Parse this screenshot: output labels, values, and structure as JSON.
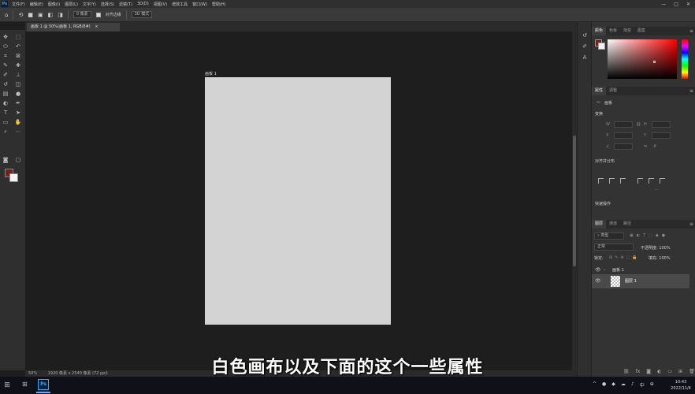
{
  "menubar": {
    "logo": "Ps",
    "items": [
      "文件(F)",
      "编辑(E)",
      "图像(I)",
      "图层(L)",
      "文字(Y)",
      "选择(S)",
      "滤镜(T)",
      "3D(D)",
      "视图(V)",
      "增效工具",
      "窗口(W)",
      "帮助(H)"
    ],
    "window_controls": [
      "—",
      "□",
      "✕"
    ]
  },
  "options": {
    "home_icon": "⌂",
    "width_value": "0 像素",
    "align_edges_label": "对齐边缘",
    "mode_value": "3D 模式"
  },
  "document": {
    "tab_title": "画板 1 @ 50%(画板 1, RGB/8#)",
    "tab_close": "×",
    "artboard_label": "画板 1"
  },
  "status": {
    "zoom": "50%",
    "text": "1920 像素 x 2540 像素 (72 ppi)"
  },
  "panels": {
    "color_tabs": [
      "颜色",
      "色板",
      "渐变",
      "图案"
    ],
    "properties_tabs": [
      "属性",
      "调整"
    ],
    "properties_layer_type": "画板",
    "transform_label": "变换",
    "transform_fields": {
      "w_label": "W",
      "h_label": "H",
      "x_label": "X",
      "y_label": "Y",
      "angle_label": "∠"
    },
    "align_label": "对齐并分布",
    "quick_actions_label": "快速操作",
    "layers_tabs": [
      "图层",
      "通道",
      "路径"
    ],
    "kind_value": "类型",
    "blend_mode": "正常",
    "opacity_label": "不透明度: 100%",
    "lock_label": "锁定:",
    "fill_label": "填充: 100%",
    "layers": [
      {
        "name": "画板 1",
        "type": "artboard"
      },
      {
        "name": "图层 1",
        "type": "layer"
      }
    ],
    "footer_icons": [
      "link-icon",
      "fx-icon",
      "mask-icon",
      "adjustment-icon",
      "folder-icon",
      "new-layer-icon",
      "trash-icon"
    ]
  },
  "subtitle": "白色画布以及下面的这个一些属性",
  "taskbar": {
    "start_icon": "⊞",
    "task_view_icon": "⊞",
    "ps_label": "Ps",
    "tray_icons": [
      "^",
      "●",
      "◆",
      "☁",
      "♪",
      "中",
      "⊕"
    ],
    "time": "10:43",
    "date": "2022/11/4"
  }
}
